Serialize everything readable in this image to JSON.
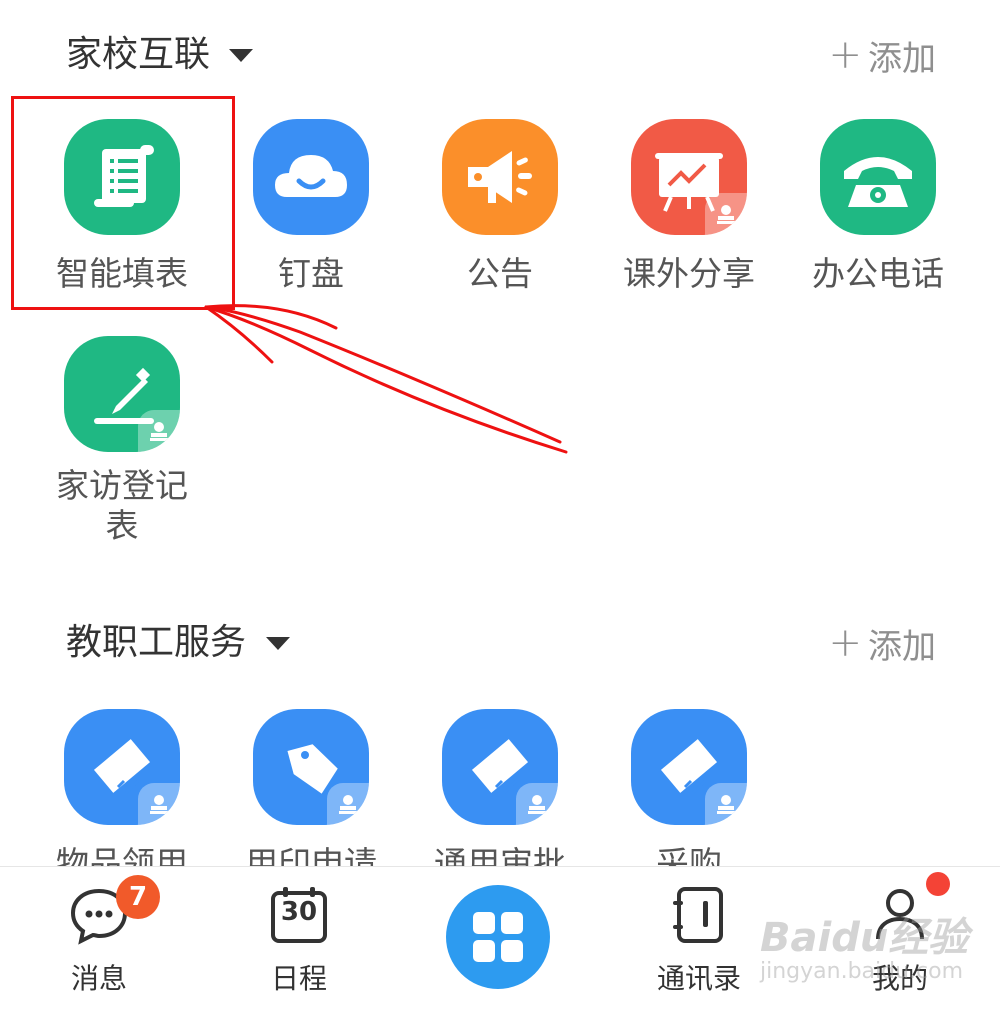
{
  "sections": {
    "home_school": {
      "title": "家校互联",
      "add_label": "添加",
      "apps": [
        {
          "label": "智能填表",
          "icon": "scroll-list-icon",
          "color": "#1fb883"
        },
        {
          "label": "钉盘",
          "icon": "cloud-smile-icon",
          "color": "#3a8ff4"
        },
        {
          "label": "公告",
          "icon": "megaphone-icon",
          "color": "#fb8f2a"
        },
        {
          "label": "课外分享",
          "icon": "presentation-board-icon",
          "color": "#f15a46"
        },
        {
          "label": "办公电话",
          "icon": "telephone-icon",
          "color": "#1fb883"
        },
        {
          "label": "家访登记表",
          "icon": "pen-sign-icon",
          "color": "#1fb883"
        }
      ]
    },
    "staff_services": {
      "title": "教职工服务",
      "add_label": "添加",
      "apps": [
        {
          "label": "物品领用",
          "icon": "ruler-tag-icon",
          "color": "#3a8ff4"
        },
        {
          "label": "用印申请",
          "icon": "price-tag-icon",
          "color": "#3a8ff4"
        },
        {
          "label": "通用审批",
          "icon": "ruler-tag-icon",
          "color": "#3a8ff4"
        },
        {
          "label": "采购",
          "icon": "ruler-tag-icon",
          "color": "#3a8ff4"
        }
      ]
    }
  },
  "tabbar": {
    "items": [
      {
        "label": "消息",
        "icon": "chat-bubble-icon",
        "badge": "7"
      },
      {
        "label": "日程",
        "icon": "calendar-icon",
        "calendar_day": "30"
      },
      {
        "label": "",
        "icon": "grid-apps-icon"
      },
      {
        "label": "通讯录",
        "icon": "contacts-book-icon"
      },
      {
        "label": "我的",
        "icon": "user-profile-icon"
      }
    ]
  },
  "watermark": {
    "main": "Baidu经验",
    "sub": "jingyan.baidu.com"
  },
  "colors": {
    "accent_blue": "#2d9bf0",
    "annotation_red": "#ee1111",
    "badge_red": "#f15a2a"
  }
}
